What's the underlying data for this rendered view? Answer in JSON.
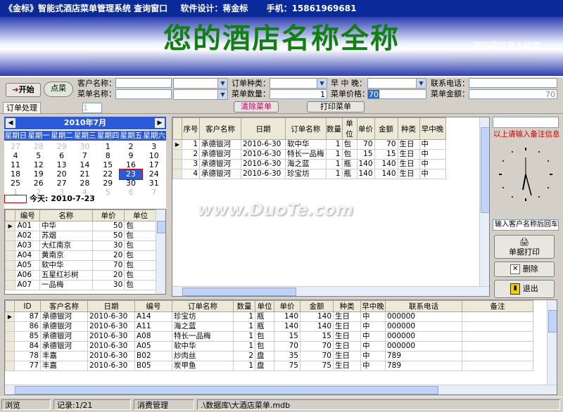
{
  "title": {
    "app": "《金标》智能式酒店菜单管理系统  查询窗口",
    "designer": "软件设计：蒋金标",
    "phone": "手机：15861969681"
  },
  "banner": {
    "hotel_name": "您的酒店名称全称",
    "subtitle": "酒店菜单录入管理"
  },
  "form": {
    "start_btn": "开始",
    "order_btn": "点菜",
    "customer_label": "客户名称：",
    "dish_label": "菜单名称：",
    "order_type_label": "订单种类：",
    "qty_label": "菜单数量：",
    "qty_value": "1",
    "meal_label": "早 中 晚：",
    "price_label": "菜单价格：",
    "price_value": "70",
    "contact_label": "联系电话：",
    "amount_label": "菜单金额：",
    "amount_value": "70"
  },
  "tabs": {
    "order_tab": "订单处理",
    "counter_value": "1",
    "clear_btn": "清除菜单",
    "print_btn": "打印菜单"
  },
  "calendar": {
    "month": "2010年7月",
    "weekdays": [
      "星期日",
      "星期一",
      "星期二",
      "星期三",
      "星期四",
      "星期五",
      "星期六"
    ],
    "today_label": "今天:  2010-7-23",
    "selected": "23",
    "weeks": [
      [
        "27",
        "28",
        "29",
        "30",
        "1",
        "2",
        "3"
      ],
      [
        "4",
        "5",
        "6",
        "7",
        "8",
        "9",
        "10"
      ],
      [
        "11",
        "12",
        "13",
        "14",
        "15",
        "16",
        "17"
      ],
      [
        "18",
        "19",
        "20",
        "21",
        "22",
        "23",
        "24"
      ],
      [
        "25",
        "26",
        "27",
        "28",
        "29",
        "30",
        "31"
      ],
      [
        "1",
        "2",
        "3",
        "4",
        "5",
        "6",
        "7"
      ]
    ]
  },
  "menu_list": {
    "headers": [
      "编号",
      "名称",
      "单价",
      "单位"
    ],
    "rows": [
      [
        "A01",
        "中华",
        "50",
        "包"
      ],
      [
        "A02",
        "苏烟",
        "50",
        "包"
      ],
      [
        "A03",
        "大红南京",
        "30",
        "包"
      ],
      [
        "A04",
        "黄南京",
        "20",
        "包"
      ],
      [
        "A05",
        "软中华",
        "70",
        "包"
      ],
      [
        "A06",
        "五星红衫树",
        "20",
        "包"
      ],
      [
        "A07",
        "一品梅",
        "30",
        "包"
      ]
    ]
  },
  "order_grid": {
    "headers": [
      "序号",
      "客户名称",
      "日期",
      "订单名称",
      "数量",
      "单位",
      "单价",
      "金额",
      "种类",
      "早中晚"
    ],
    "rows": [
      [
        "1",
        "承德银河",
        "2010-6-30",
        "软中华",
        "1",
        "包",
        "70",
        "70",
        "生日",
        "中"
      ],
      [
        "2",
        "承德银河",
        "2010-6-30",
        "特长一品梅",
        "1",
        "包",
        "15",
        "15",
        "生日",
        "中"
      ],
      [
        "3",
        "承德银河",
        "2010-6-30",
        "海之蓝",
        "1",
        "瓶",
        "140",
        "140",
        "生日",
        "中"
      ],
      [
        "4",
        "承德银河",
        "2010-6-30",
        "珍宝坊",
        "1",
        "瓶",
        "140",
        "140",
        "生日",
        "中"
      ]
    ]
  },
  "side": {
    "notes_hint": "以上请输入备注信息",
    "input_hint": "输入客户名称后回车",
    "print_btn": "单据打印",
    "delete_btn": "删除",
    "exit_btn": "退出"
  },
  "records": {
    "headers": [
      "ID",
      "客户名称",
      "日期",
      "编号",
      "订单名称",
      "数量",
      "单位",
      "单价",
      "金额",
      "种类",
      "早中晚",
      "联系电话",
      "备注"
    ],
    "rows": [
      [
        "87",
        "承德银河",
        "2010-6-30",
        "A14",
        "珍宝坊",
        "1",
        "瓶",
        "140",
        "140",
        "生日",
        "中",
        "000000",
        ""
      ],
      [
        "86",
        "承德银河",
        "2010-6-30",
        "A11",
        "海之蓝",
        "1",
        "瓶",
        "140",
        "140",
        "生日",
        "中",
        "000000",
        ""
      ],
      [
        "85",
        "承德银河",
        "2010-6-30",
        "A08",
        "特长一品梅",
        "1",
        "包",
        "15",
        "15",
        "生日",
        "中",
        "000000",
        ""
      ],
      [
        "84",
        "承德银河",
        "2010-6-30",
        "A05",
        "软中华",
        "1",
        "包",
        "70",
        "70",
        "生日",
        "中",
        "000000",
        ""
      ],
      [
        "78",
        "丰嘉",
        "2010-6-30",
        "B02",
        "炒肉丝",
        "2",
        "盘",
        "35",
        "70",
        "生日",
        "中",
        "789",
        ""
      ],
      [
        "77",
        "丰嘉",
        "2010-6-30",
        "B05",
        "炭甲鱼",
        "1",
        "盘",
        "75",
        "75",
        "生日",
        "中",
        "789",
        ""
      ]
    ]
  },
  "status": {
    "mode": "浏览",
    "record": "记录:1/21",
    "module": "消费管理",
    "path": ".\\数据库\\大酒店菜单.mdb"
  },
  "watermark": "www.DuoTe.com"
}
